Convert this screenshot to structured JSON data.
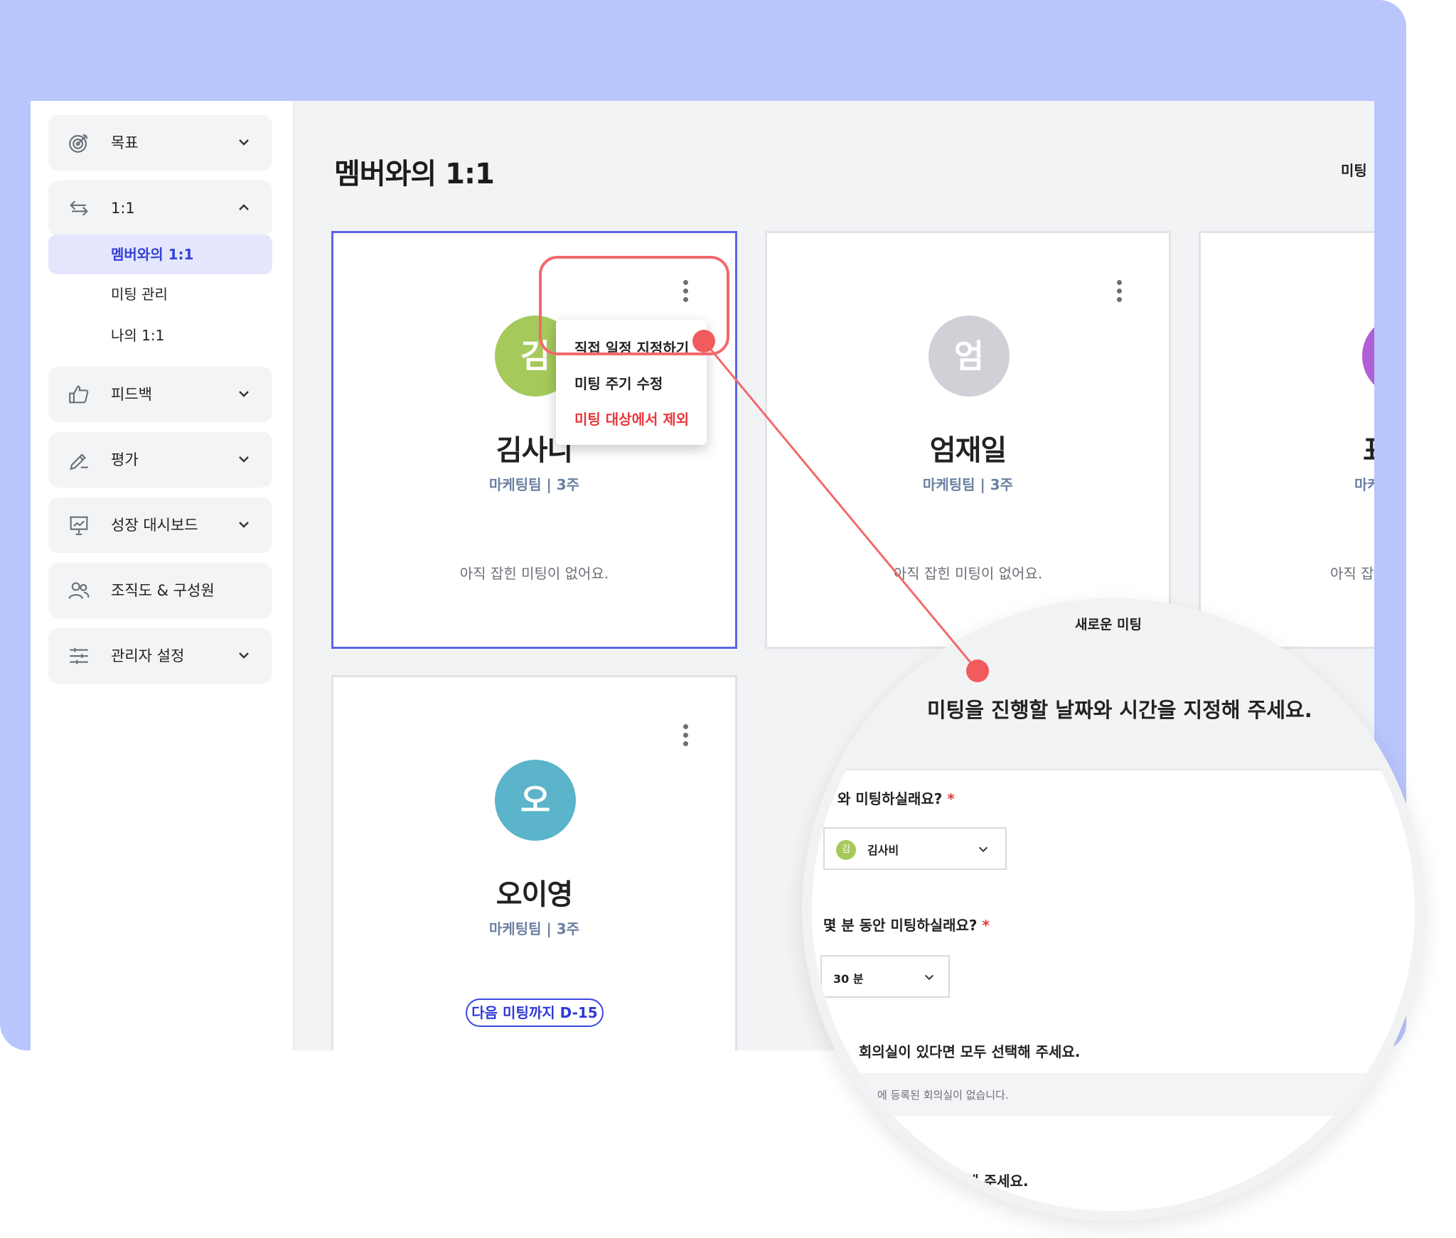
{
  "sidebar": {
    "items": [
      {
        "label": "목표",
        "icon": "target-icon"
      },
      {
        "label": "1:1",
        "icon": "swap-arrows-icon",
        "expanded": true,
        "children": [
          {
            "label": "멤버와의 1:1",
            "active": true
          },
          {
            "label": "미팅 관리"
          },
          {
            "label": "나의 1:1"
          }
        ]
      },
      {
        "label": "피드백",
        "icon": "thumbs-up-icon"
      },
      {
        "label": "평가",
        "icon": "pen-icon"
      },
      {
        "label": "성장 대시보드",
        "icon": "presentation-chart-icon"
      },
      {
        "label": "조직도 & 구성원",
        "icon": "users-icon"
      },
      {
        "label": "관리자 설정",
        "icon": "sliders-icon"
      }
    ]
  },
  "main": {
    "title": "멤버와의 1:1",
    "header_right": "미팅 ",
    "cards": [
      {
        "initial": "김",
        "name": "김사비",
        "name_visible": "김사니",
        "team": "마케팅팀",
        "period": "3주",
        "team_line": "마케팅팀  |  3주",
        "status": "아직 잡힌 미팅이 없어요.",
        "avatar_color": "#a6c95b"
      },
      {
        "initial": "엄",
        "name": "엄재일",
        "team": "마케팅팀",
        "period": "3주",
        "team_line": "마케팅팀  |  3주",
        "status": "아직 잡힌 미팅이 없어요.",
        "avatar_color": "#cfd1d6"
      },
      {
        "initial": "표",
        "name_partial": "표",
        "team_partial": "마케",
        "status_partial": "아직 잡힌",
        "avatar_color": "#b05fd6"
      },
      {
        "initial": "오",
        "name": "오이영",
        "team": "마케팅팀",
        "period": "3주",
        "team_line": "마케팅팀  |  3주",
        "badge": "다음 미팅까지 D-15",
        "avatar_color": "#5bb4c9"
      }
    ],
    "context_menu": {
      "items": [
        {
          "label": "직접 일정 지정하기"
        },
        {
          "label": "미팅 주기 수정"
        },
        {
          "label": "미팅 대상에서 제외",
          "danger": true
        }
      ]
    }
  },
  "zoom": {
    "modal_title": "새로운 미팅",
    "heading": "미팅을 진행할 날짜와 시간을 지정해 주세요.",
    "q_who": "와 미팅하실래요?",
    "q_who_prefix": "누",
    "who_value": "김사비",
    "who_initial": "김",
    "q_duration": "몇 분 동안 미팅하실래요?",
    "duration_value": "30 분",
    "q_rooms": "회의실이 있다면 모두 선택해 주세요.",
    "rooms_empty": "에 등록된 회의실이 없습니다.",
    "q_last": "정해 주세요.",
    "required_mark": "*"
  },
  "colors": {
    "frame_bg": "#b9c5fd",
    "accent": "#3342d6",
    "highlight": "#f2696c",
    "danger": "#e8363a"
  }
}
